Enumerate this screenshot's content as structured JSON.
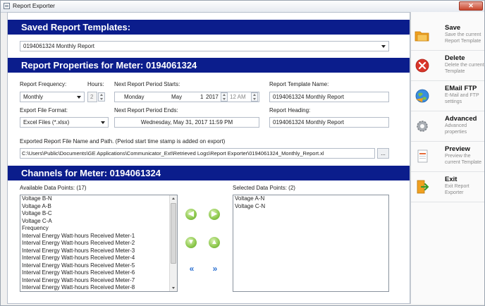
{
  "window": {
    "title": "Report Exporter",
    "close_label": "✕"
  },
  "saved_templates": {
    "header": "Saved Report Templates:",
    "selected": "0194061324 Monthly Report"
  },
  "properties": {
    "header": "Report Properties for Meter: 0194061324",
    "report_frequency_label": "Report Frequency:",
    "report_frequency_value": "Monthly",
    "hours_label": "Hours:",
    "hours_value": "2",
    "next_start_label": "Next Report Period Starts:",
    "start_day": "Monday",
    "start_month": "May",
    "start_date": "1",
    "start_year": "2017",
    "start_time": "12 AM",
    "template_name_label": "Report Template Name:",
    "template_name_value": "0194061324 Monthly Report",
    "export_format_label": "Export File Format:",
    "export_format_value": "Excel Files (*.xlsx)",
    "next_end_label": "Next Report Period Ends:",
    "next_end_value": "Wednesday, May 31, 2017 11:59 PM",
    "heading_label": "Report Heading:",
    "heading_value": "0194061324 Monthly Report",
    "path_label": "Exported Report File Name and Path.  (Period start time stamp is added on export)",
    "path_value": "C:\\Users\\Public\\Documents\\GE Applications\\Communicator_Ext\\Retrieved Logs\\Report Exporter\\0194061324_Monthly_Report.xl",
    "browse_label": "..."
  },
  "channels": {
    "header": "Channels for Meter: 0194061324",
    "available_label": "Available Data Points: (17)",
    "selected_label": "Selected Data Points: (2)",
    "available_items": [
      "Voltage B-N",
      "Voltage A-B",
      "Voltage B-C",
      "Voltage C-A",
      "Frequency",
      "Interval Energy Watt-hours Received Meter-1",
      "Interval Energy Watt-hours Received Meter-2",
      "Interval Energy Watt-hours Received Meter-3",
      "Interval Energy Watt-hours Received Meter-4",
      "Interval Energy Watt-hours Received Meter-5",
      "Interval Energy Watt-hours Received Meter-6",
      "Interval Energy Watt-hours Received Meter-7",
      "Interval Energy Watt-hours Received Meter-8"
    ],
    "selected_items": [
      "Voltage A-N",
      "Voltage C-N"
    ],
    "move_buttons": {
      "left": "◀",
      "right": "▶",
      "down": "▼",
      "up": "▲",
      "all_left": "«",
      "all_right": "»"
    }
  },
  "sidebar": {
    "items": [
      {
        "title": "Save",
        "desc": "Save the current Report Template",
        "icon": "folder-save-icon"
      },
      {
        "title": "Delete",
        "desc": "Delete the current Template",
        "icon": "delete-icon"
      },
      {
        "title": "EMail  FTP",
        "desc": "E-Mail and FTP settings",
        "icon": "globe-icon"
      },
      {
        "title": "Advanced",
        "desc": "Advanced properties",
        "icon": "gear-icon"
      },
      {
        "title": "Preview",
        "desc": "Preview the current Template",
        "icon": "preview-icon"
      },
      {
        "title": "Exit",
        "desc": "Exit Report Exporter",
        "icon": "exit-door-icon"
      }
    ]
  },
  "colors": {
    "header_bg": "#0b1d8c",
    "accent_orange": "#f0a020",
    "delete_red": "#d9362a"
  }
}
